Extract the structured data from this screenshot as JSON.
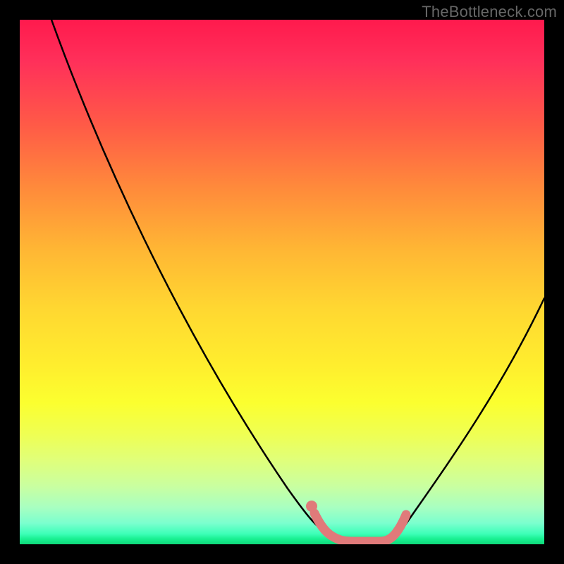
{
  "watermark": "TheBottleneck.com",
  "colors": {
    "background": "#000000",
    "curve": "#000000",
    "highlight": "#e07a7a",
    "gradient_top": "#ff1a4d",
    "gradient_bottom": "#0fd879"
  },
  "chart_data": {
    "type": "line",
    "title": "",
    "xlabel": "",
    "ylabel": "",
    "xlim": [
      0,
      100
    ],
    "ylim": [
      0,
      100
    ],
    "grid": false,
    "series": [
      {
        "name": "bottleneck-curve",
        "x": [
          6,
          10,
          15,
          20,
          25,
          30,
          35,
          40,
          45,
          50,
          53,
          56,
          58,
          60,
          62,
          65,
          68,
          72,
          76,
          80,
          85,
          90,
          95,
          100
        ],
        "y": [
          100,
          92,
          83,
          74,
          65,
          56,
          47,
          38,
          29,
          19,
          12,
          6,
          3,
          1,
          0,
          0,
          0,
          1,
          5,
          11,
          19,
          28,
          37,
          47
        ]
      }
    ],
    "highlight_segment": {
      "name": "optimal-zone",
      "x": [
        55,
        57,
        59,
        61,
        63,
        65,
        67,
        69,
        71
      ],
      "y": [
        6,
        3,
        1,
        0,
        0,
        0,
        0,
        1,
        4
      ]
    },
    "highlight_marker": {
      "x": 55,
      "y": 6
    }
  }
}
